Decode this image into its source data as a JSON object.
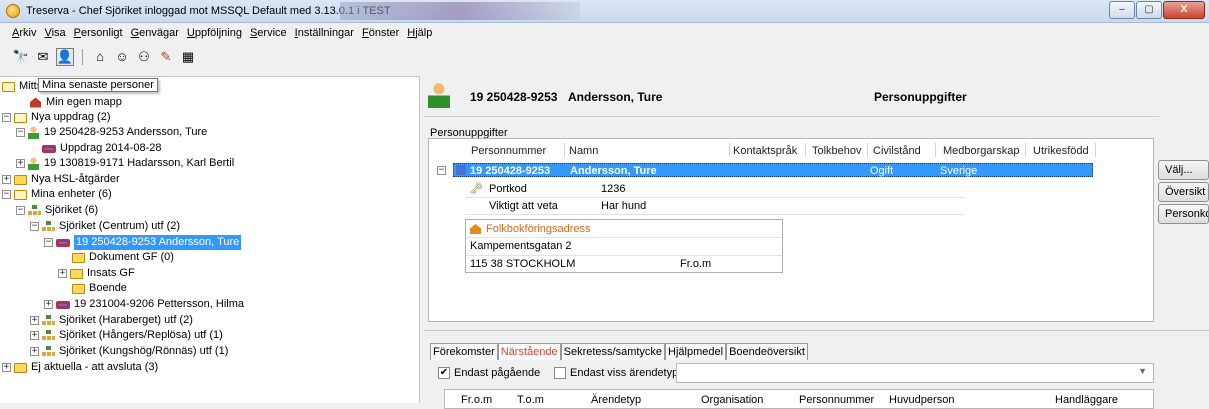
{
  "window": {
    "title": "Treserva - Chef Sjöriket inloggad mot MSSQL Default  med 3.13.0.1 i TEST",
    "min": "–",
    "max": "▢",
    "close": "X"
  },
  "menu": [
    "Arkiv",
    "Visa",
    "Personligt",
    "Genvägar",
    "Uppföljning",
    "Service",
    "Inställningar",
    "Fönster",
    "Hjälp"
  ],
  "toolbar": {
    "icons": [
      "binoculars-icon",
      "mail-icon",
      "recent-persons-icon",
      "home-icon",
      "group-icon",
      "family-icon",
      "pen-icon",
      "calendar-icon"
    ]
  },
  "tooltip": "Mina senaste personer",
  "tree": {
    "root": "Mitts",
    "my_folder": "Min egen mapp",
    "new_assignments": "Nya uppdrag (2)",
    "person1": "19 250428-9253  Andersson, Ture",
    "assignment1": "Uppdrag 2014-08-28",
    "person2": "19 130819-9171  Hadarsson, Karl Bertil",
    "hsl": "Nya HSL-åtgärder",
    "my_units": "Mina enheter (6)",
    "sjoriket": "Sjöriket (6)",
    "centrum": "Sjöriket (Centrum) utf (2)",
    "selected_case": "19 250428-9253 Andersson, Ture",
    "doc_gf": "Dokument GF (0)",
    "insats_gf": "Insats GF",
    "boende": "Boende",
    "person3": "19 231004-9206 Pettersson, Hilma",
    "haraberget": "Sjöriket (Haraberget) utf (2)",
    "hangers": "Sjöriket (Hångers/Replösa) utf (1)",
    "kungshog": "Sjöriket (Kungshög/Rönnäs) utf (1)",
    "ej_aktuella": "Ej aktuella - att avsluta (3)"
  },
  "header": {
    "pnr": "19 250428-9253",
    "name": "Andersson, Ture",
    "section": "Personuppgifter"
  },
  "group_label": "Personuppgifter",
  "grid": {
    "columns": [
      "Personnummer",
      "Namn",
      "Kontaktspråk",
      "Tolkbehov",
      "Civilstånd",
      "Medborgarskap",
      "Utrikesfödd"
    ],
    "row": {
      "pnr": "19 250428-9253",
      "name": "Andersson, Ture",
      "civil": "Ogift",
      "citizenship": "Sverige"
    },
    "details": [
      {
        "label": "Portkod",
        "value": "1236"
      },
      {
        "label": "Viktigt att veta",
        "value": "Har hund"
      }
    ],
    "address": {
      "title": "Folkbokföringsadress",
      "street": "Kampementsgatan 2",
      "city": "115 38  STOCKHOLM",
      "from": "Fr.o.m"
    }
  },
  "side_buttons": [
    "Välj...",
    "Översikt",
    "Personkort"
  ],
  "tabs": [
    "Förekomster",
    "Närstående",
    "Sekretess/samtycke",
    "Hjälpmedel",
    "Boendeöversikt"
  ],
  "filters": {
    "ongoing": "Endast pågående",
    "certain_types": "Endast viss ärendetyp"
  },
  "bottom_grid": {
    "columns": [
      "Fr.o.m",
      "T.o.m",
      "Ärendetyp",
      "Organisation",
      "Personnummer",
      "Huvudperson",
      "Handläggare"
    ]
  },
  "colors": {
    "selection": "#3399ff",
    "tab_active_text": "#d2452f"
  }
}
